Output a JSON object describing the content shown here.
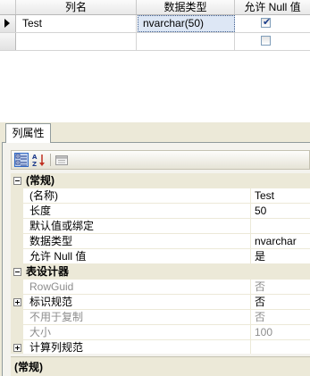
{
  "grid": {
    "columns": [
      "列名",
      "数据类型",
      "允许 Null 值"
    ],
    "rows": [
      {
        "name": "Test",
        "type": "nvarchar(50)",
        "allow_null": true,
        "current": true
      },
      {
        "name": "",
        "type": "",
        "allow_null": false,
        "current": false
      }
    ]
  },
  "panel": {
    "tab_label": "列属性",
    "toolbar": {
      "categorized_icon": "categorized-icon",
      "alphabetical_icon": "sort-alphabetical-icon",
      "property_pages_icon": "property-pages-icon"
    },
    "properties": [
      {
        "kind": "category",
        "label": "(常规)",
        "expander": "minus"
      },
      {
        "kind": "prop",
        "name": "(名称)",
        "value": "Test"
      },
      {
        "kind": "prop",
        "name": "长度",
        "value": "50"
      },
      {
        "kind": "prop",
        "name": "默认值或绑定",
        "value": ""
      },
      {
        "kind": "prop",
        "name": "数据类型",
        "value": "nvarchar"
      },
      {
        "kind": "prop",
        "name": "允许 Null 值",
        "value": "是"
      },
      {
        "kind": "category",
        "label": "表设计器",
        "expander": "minus"
      },
      {
        "kind": "prop",
        "name": "RowGuid",
        "value": "否",
        "disabled": true
      },
      {
        "kind": "prop",
        "name": "标识规范",
        "value": "否",
        "expander": "plus"
      },
      {
        "kind": "prop",
        "name": "不用于复制",
        "value": "否",
        "disabled": true
      },
      {
        "kind": "prop",
        "name": "大小",
        "value": "100",
        "disabled": true
      },
      {
        "kind": "prop",
        "name": "计算列规范",
        "value": "",
        "expander": "plus"
      }
    ],
    "description_title": "(常规)"
  }
}
